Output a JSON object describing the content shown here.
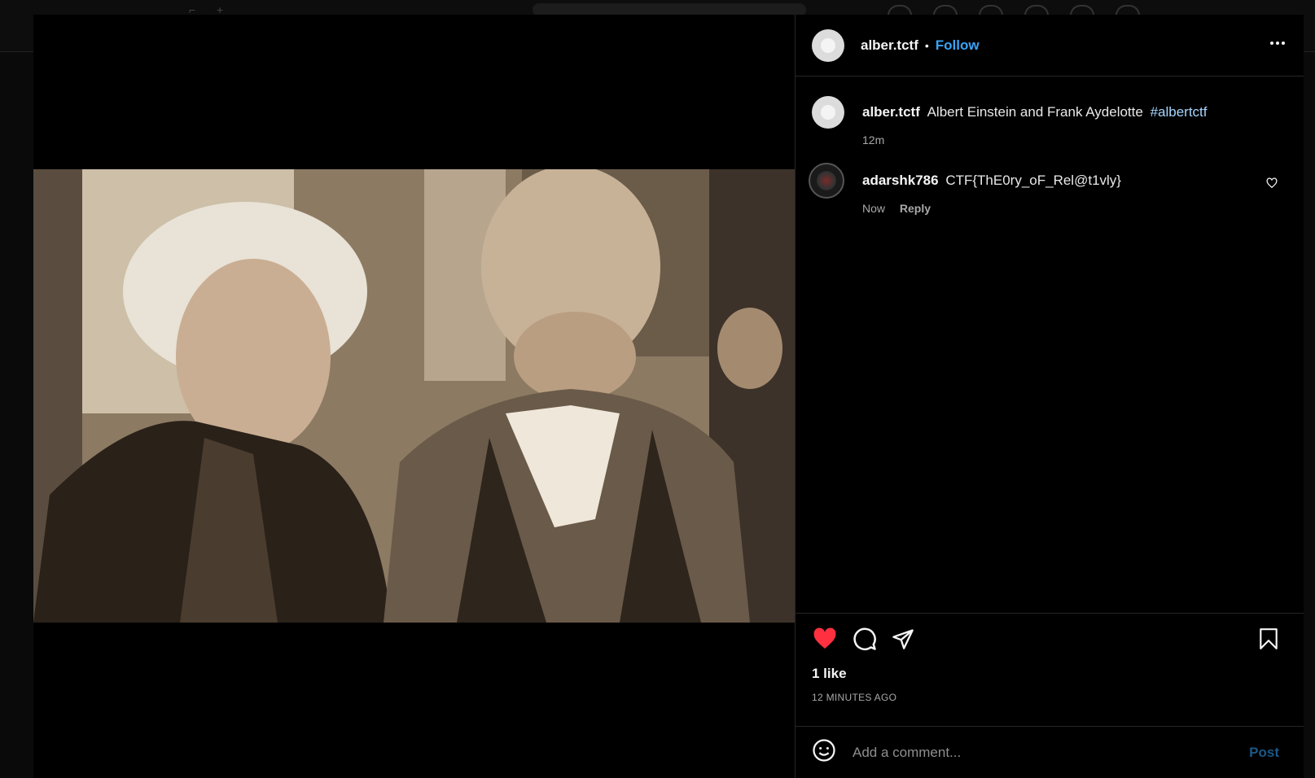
{
  "post": {
    "author": "alber.tctf",
    "separator": "•",
    "follow_label": "Follow",
    "more_label": "•••",
    "caption": {
      "username": "alber.tctf",
      "text": "Albert Einstein and Frank Aydelotte",
      "hashtag": "#albertctf",
      "time": "12m"
    },
    "comments": [
      {
        "username": "adarshk786",
        "text": "CTF{ThE0ry_oF_Rel@t1vly}",
        "time": "Now",
        "reply_label": "Reply"
      }
    ],
    "likes_label": "1 like",
    "timestamp": "12 MINUTES AGO",
    "comment_placeholder": "Add a comment...",
    "post_label": "Post"
  },
  "colors": {
    "like_active": "#ff3040",
    "link": "#3aa3f5",
    "hashtag": "#a5d6ff",
    "post_disabled": "#1d5785"
  },
  "icons": {
    "like": "heart-icon",
    "comment": "comment-icon",
    "share": "send-icon",
    "save": "bookmark-icon",
    "emoji": "emoji-icon",
    "more": "more-options-icon"
  }
}
